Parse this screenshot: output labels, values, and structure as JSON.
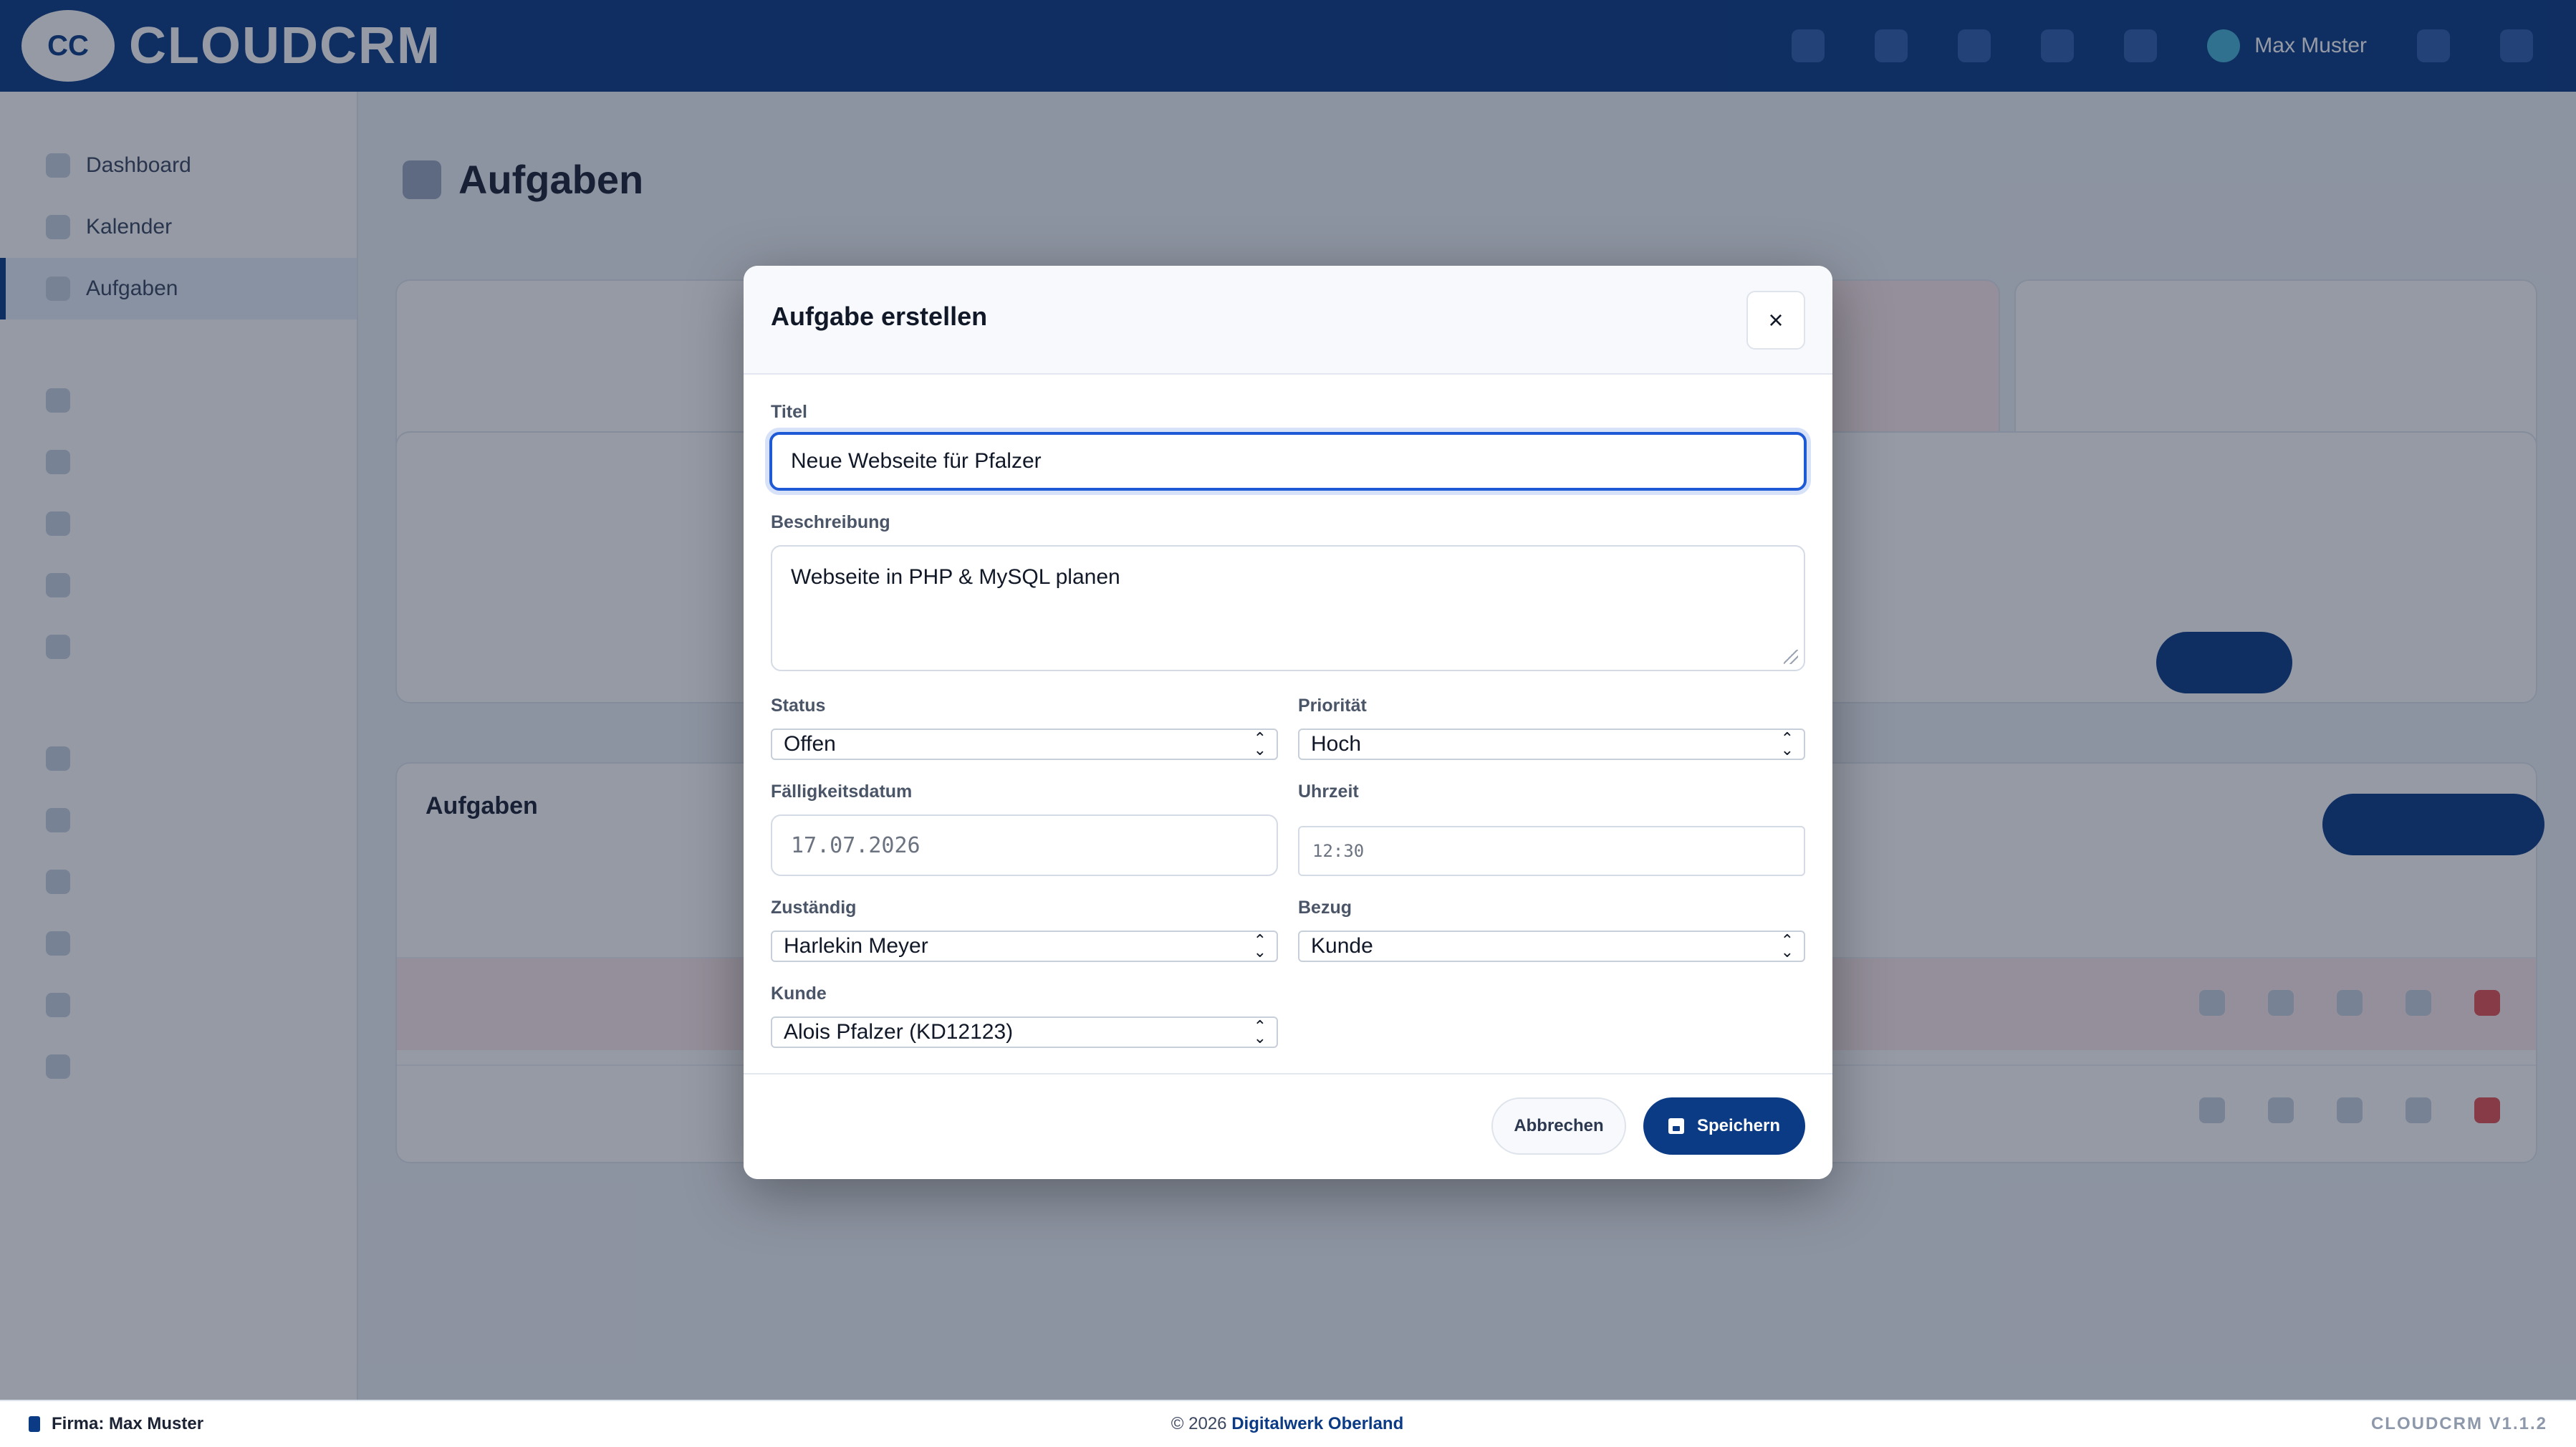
{
  "app": {
    "logo_text": "CLOUDCRM",
    "logo_badge": "CC"
  },
  "topbar": {
    "user_name": "Max Muster"
  },
  "sidebar": {
    "items": [
      {
        "label": "Dashboard"
      },
      {
        "label": "Kalender"
      },
      {
        "label": "Aufgaben",
        "active": true
      }
    ]
  },
  "page": {
    "title": "Aufgaben"
  },
  "list": {
    "title": "Aufgaben"
  },
  "modal": {
    "title": "Aufgabe erstellen",
    "close_label": "×",
    "fields": {
      "title": {
        "label": "Titel",
        "value": "Neue Webseite für Pfalzer"
      },
      "description": {
        "label": "Beschreibung",
        "value": "Webseite in PHP & MySQL planen"
      },
      "status": {
        "label": "Status",
        "value": "Offen"
      },
      "priority": {
        "label": "Priorität",
        "value": "Hoch"
      },
      "due_date": {
        "label": "Fälligkeitsdatum",
        "value": "17.07.2026"
      },
      "time": {
        "label": "Uhrzeit",
        "value": "12:30"
      },
      "assignee": {
        "label": "Zuständig",
        "value": "Harlekin Meyer"
      },
      "relation": {
        "label": "Bezug",
        "value": "Kunde"
      },
      "customer": {
        "label": "Kunde",
        "value": "Alois Pfalzer (KD12123)"
      }
    },
    "buttons": {
      "cancel": "Abbrechen",
      "save": "Speichern"
    }
  },
  "footer": {
    "company": "Firma: Max Muster",
    "copyright": "© 2026",
    "vendor": "Digitalwerk Oberland",
    "version": "CLOUDCRM V1.1.2"
  }
}
